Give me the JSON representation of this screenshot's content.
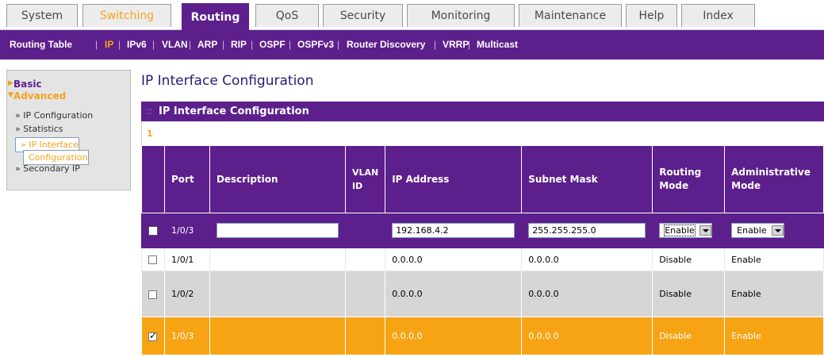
{
  "tabs": [
    "System",
    "Switching",
    "Routing",
    "QoS",
    "Security",
    "Monitoring",
    "Maintenance",
    "Help",
    "Index"
  ],
  "subnav": [
    "Routing Table",
    "IP",
    "IPv6",
    "VLAN",
    "ARP",
    "RIP",
    "OSPF",
    "OSPFv3",
    "Router Discovery",
    "VRRP",
    "Multicast"
  ],
  "leftnav": {
    "basic": "Basic",
    "advanced": "Advanced",
    "items": [
      "» IP Configuration",
      "» Statistics",
      "» IP Interface",
      "Configuration",
      "» Secondary IP"
    ]
  },
  "page_title": "IP Interface Configuration",
  "panel_title": "IP Interface Configuration",
  "page_number": "1",
  "table": {
    "headers": {
      "port": "Port",
      "description": "Description",
      "vlan_1": "VLAN",
      "vlan_2": "ID",
      "ip": "IP Address",
      "mask": "Subnet Mask",
      "routing_1": "Routing",
      "routing_2": "Mode",
      "admin_1": "Administrative",
      "admin_2": "Mode"
    },
    "edit_row": {
      "port": "1/0/3",
      "description": "",
      "ip": "192.168.4.2",
      "mask": "255.255.255.0",
      "routing_mode": "Enable",
      "admin_mode": "Enable"
    },
    "rows": [
      {
        "port": "1/0/1",
        "description": "",
        "vlan": "",
        "ip": "0.0.0.0",
        "mask": "0.0.0.0",
        "routing": "Disable",
        "admin": "Enable",
        "checked": false
      },
      {
        "port": "1/0/2",
        "description": "",
        "vlan": "",
        "ip": "0.0.0.0",
        "mask": "0.0.0.0",
        "routing": "Disable",
        "admin": "Enable",
        "checked": false
      },
      {
        "port": "1/0/3",
        "description": "",
        "vlan": "",
        "ip": "0.0.0.0",
        "mask": "0.0.0.0",
        "routing": "Disable",
        "admin": "Enable",
        "checked": true
      }
    ]
  },
  "colors": {
    "brand_purple": "#5d1f8c",
    "accent_orange": "#f7a21b"
  }
}
